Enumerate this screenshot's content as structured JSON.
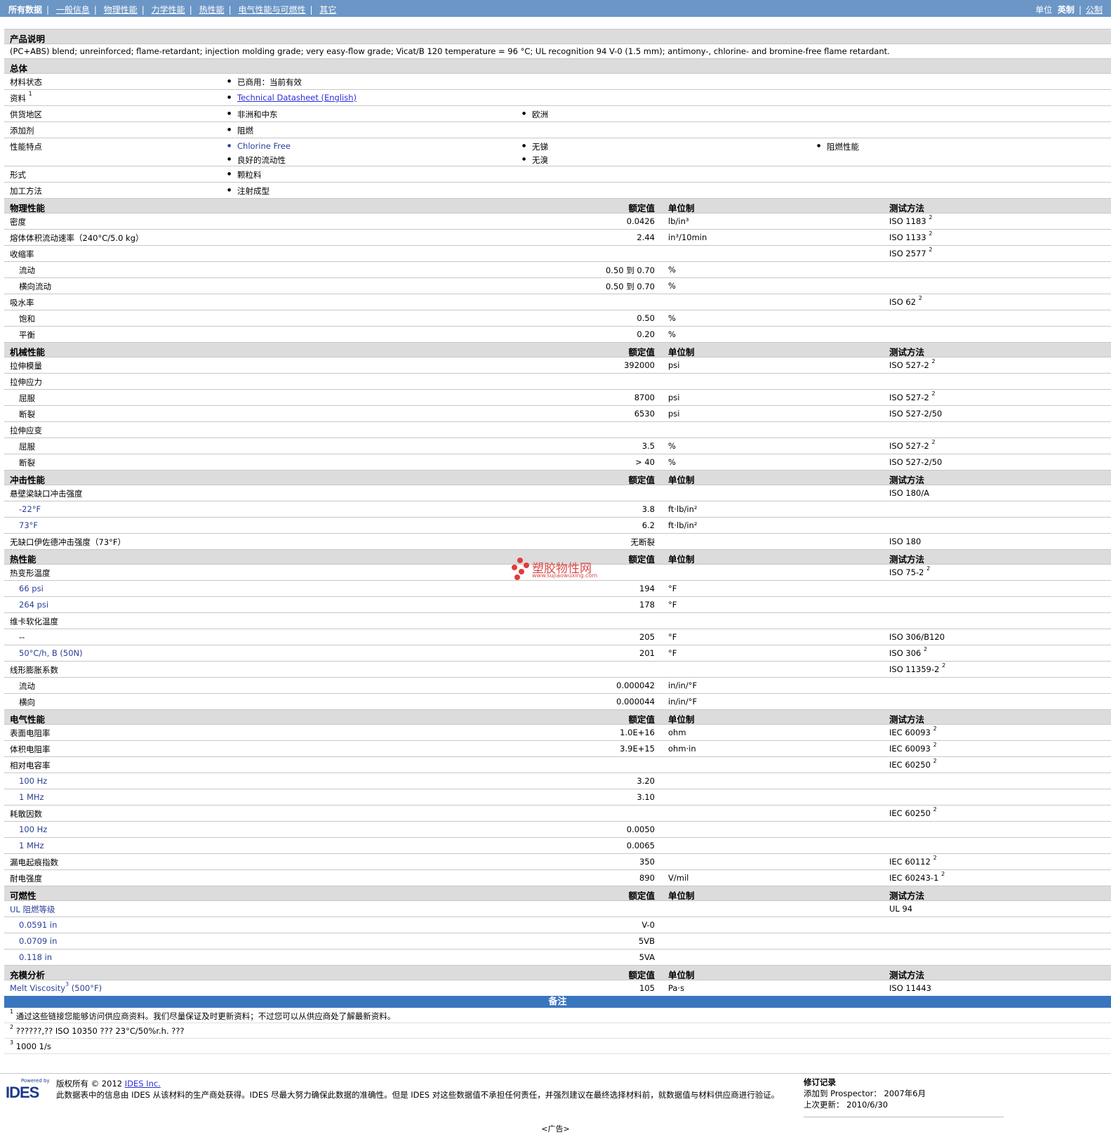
{
  "nav": {
    "tabs": [
      "所有数据",
      "一般信息",
      "物理性能",
      "力学性能",
      "热性能",
      "电气性能与可燃性",
      "其它"
    ],
    "units_label": "单位",
    "unit_imperial": "英制",
    "unit_metric": "公制"
  },
  "product": {
    "title": "产品说明",
    "description": "(PC+ABS) blend; unreinforced; flame-retardant; injection molding grade; very easy-flow grade; Vicat/B 120 temperature = 96 °C; UL recognition 94 V-0 (1.5 mm); antimony-, chlorine- and bromine-free flame retardant."
  },
  "general": {
    "title": "总体",
    "status_label": "材料状态",
    "status_value": "已商用：当前有效",
    "doc_label": "资料",
    "doc_sup": "1",
    "doc_link": "Technical Datasheet (English)",
    "region_label": "供货地区",
    "region_1": "非洲和中东",
    "region_2": "欧洲",
    "additive_label": "添加剂",
    "additive_value": "阻燃",
    "features_label": "性能特点",
    "feature_1": "Chlorine Free",
    "feature_2": "无锑",
    "feature_3": "阻燃性能",
    "feature_4": "良好的流动性",
    "feature_5": "无溴",
    "form_label": "形式",
    "form_value": "颗粒料",
    "process_label": "加工方法",
    "process_value": "注射成型"
  },
  "headers": {
    "value": "额定值",
    "unit": "单位制",
    "test": "测试方法"
  },
  "sections": [
    {
      "title": "物理性能",
      "rows": [
        {
          "label": "密度",
          "value": "0.0426",
          "unit": "lb/in³",
          "test": "ISO 1183",
          "sup": "2"
        },
        {
          "label": "熔体体积流动速率（240°C/5.0 kg）",
          "value": "2.44",
          "unit": "in³/10min",
          "test": "ISO 1133",
          "sup": "2"
        },
        {
          "label": "收缩率",
          "test": "ISO 2577",
          "sup": "2"
        },
        {
          "label": "流动",
          "sub": true,
          "value": "0.50 到  0.70",
          "unit": "%"
        },
        {
          "label": "横向流动",
          "sub": true,
          "value": "0.50 到  0.70",
          "unit": "%"
        },
        {
          "label": "吸水率",
          "test": "ISO 62",
          "sup": "2"
        },
        {
          "label": "饱和",
          "sub": true,
          "value": "0.50",
          "unit": "%"
        },
        {
          "label": "平衡",
          "sub": true,
          "value": "0.20",
          "unit": "%"
        }
      ]
    },
    {
      "title": "机械性能",
      "rows": [
        {
          "label": "拉伸模量",
          "value": "392000",
          "unit": "psi",
          "test": "ISO 527-2",
          "sup": "2"
        },
        {
          "label": "拉伸应力"
        },
        {
          "label": "屈服",
          "sub": true,
          "value": "8700",
          "unit": "psi",
          "test": "ISO 527-2",
          "sup": "2"
        },
        {
          "label": "断裂",
          "sub": true,
          "value": "6530",
          "unit": "psi",
          "test": "ISO 527-2/50"
        },
        {
          "label": "拉伸应变"
        },
        {
          "label": "屈服",
          "sub": true,
          "value": "3.5",
          "unit": "%",
          "test": "ISO 527-2",
          "sup": "2"
        },
        {
          "label": "断裂",
          "sub": true,
          "value": "> 40",
          "unit": "%",
          "test": "ISO 527-2/50"
        }
      ]
    },
    {
      "title": "冲击性能",
      "rows": [
        {
          "label": "悬壁梁缺口冲击强度",
          "test": "ISO 180/A"
        },
        {
          "label": "-22°F",
          "sub": true,
          "blue": true,
          "value": "3.8",
          "unit": "ft·lb/in²"
        },
        {
          "label": "73°F",
          "sub": true,
          "blue": true,
          "value": "6.2",
          "unit": "ft·lb/in²"
        },
        {
          "label": "无缺口伊佐德冲击强度（73°F）",
          "value": "无断裂",
          "test": "ISO 180"
        }
      ]
    },
    {
      "title": "热性能",
      "rows": [
        {
          "label": "热变形温度",
          "test": "ISO 75-2",
          "sup": "2"
        },
        {
          "label": "66 psi",
          "sub": true,
          "blue": true,
          "value": "194",
          "unit": "°F"
        },
        {
          "label": "264 psi",
          "sub": true,
          "blue": true,
          "value": "178",
          "unit": "°F"
        },
        {
          "label": "维卡软化温度"
        },
        {
          "label": "--",
          "sub": true,
          "value": "205",
          "unit": "°F",
          "test": "ISO 306/B120"
        },
        {
          "label": "50°C/h, B (50N)",
          "sub": true,
          "blue": true,
          "value": "201",
          "unit": "°F",
          "test": "ISO 306",
          "sup": "2"
        },
        {
          "label": "线形膨胀系数",
          "test": "ISO 11359-2",
          "sup": "2"
        },
        {
          "label": "流动",
          "sub": true,
          "value": "0.000042",
          "unit": "in/in/°F"
        },
        {
          "label": "横向",
          "sub": true,
          "value": "0.000044",
          "unit": "in/in/°F"
        }
      ]
    },
    {
      "title": "电气性能",
      "rows": [
        {
          "label": "表面电阻率",
          "value": "1.0E+16",
          "unit": "ohm",
          "test": "IEC 60093",
          "sup": "2"
        },
        {
          "label": "体积电阻率",
          "value": "3.9E+15",
          "unit": "ohm·in",
          "test": "IEC 60093",
          "sup": "2"
        },
        {
          "label": "相对电容率",
          "test": "IEC 60250",
          "sup": "2"
        },
        {
          "label": "100 Hz",
          "sub": true,
          "blue": true,
          "value": "3.20"
        },
        {
          "label": "1 MHz",
          "sub": true,
          "blue": true,
          "value": "3.10"
        },
        {
          "label": "耗散因数",
          "test": "IEC 60250",
          "sup": "2"
        },
        {
          "label": "100 Hz",
          "sub": true,
          "blue": true,
          "value": "0.0050"
        },
        {
          "label": "1 MHz",
          "sub": true,
          "blue": true,
          "value": "0.0065"
        },
        {
          "label": "漏电起痕指数",
          "value": "350",
          "test": "IEC 60112",
          "sup": "2"
        },
        {
          "label": "耐电强度",
          "value": "890",
          "unit": "V/mil",
          "test": "IEC 60243-1",
          "sup": "2"
        }
      ]
    },
    {
      "title": "可燃性",
      "rows": [
        {
          "label": "UL 阻燃等级",
          "blue": true,
          "test": "UL 94"
        },
        {
          "label": "0.0591 in",
          "sub": true,
          "blue": true,
          "value": "V-0"
        },
        {
          "label": "0.0709 in",
          "sub": true,
          "blue": true,
          "value": "5VB"
        },
        {
          "label": "0.118 in",
          "sub": true,
          "blue": true,
          "value": "5VA"
        }
      ]
    },
    {
      "title": "充模分析",
      "rows": [
        {
          "label": "Melt Viscosity",
          "label_sup": "3",
          "label_tail": " (500°F)",
          "blue": true,
          "value": "105",
          "unit": "Pa·s",
          "test": "ISO 11443"
        }
      ]
    }
  ],
  "notes": {
    "title": "备注",
    "items": [
      {
        "sup": "1",
        "text": "通过这些链接您能够访问供应商资料。我们尽量保证及时更新资料；不过您可以从供应商处了解最新资料。"
      },
      {
        "sup": "2",
        "text": "??????,?? ISO 10350 ??? 23°C/50%r.h. ???"
      },
      {
        "sup": "3",
        "text": "1000 1/s"
      }
    ]
  },
  "footer": {
    "powered_by": "Powered by",
    "logo_text": "IDES",
    "copyright_prefix": "版权所有  © 2012 ",
    "copyright_link": "IDES Inc.",
    "disclaimer": "此数据表中的信息由  IDES 从该材料的生产商处获得。IDES 尽最大努力确保此数据的准确性。但是  IDES 对这些数据值不承担任何责任，并强烈建议在最终选择材料前，就数据值与材料供应商进行验证。",
    "revision_title": "修订记录",
    "added_label": "添加到 Prospector：",
    "added_value": "2007年6月",
    "updated_label": "上次更新：",
    "updated_value": "2010/6/30",
    "ad": "<广告>"
  },
  "watermark": {
    "name": "塑胶物性网",
    "url": "www.sujiaowuxing.com"
  }
}
